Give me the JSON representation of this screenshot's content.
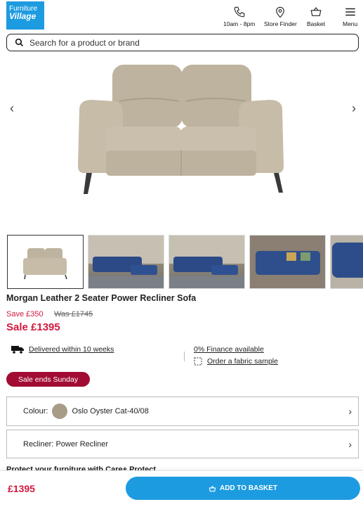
{
  "header": {
    "logo_line1": "Furniture",
    "logo_line2": "Village",
    "nav": [
      {
        "label": "10am - 8pm",
        "icon": "phone-icon"
      },
      {
        "label": "Store Finder",
        "icon": "location-pin-icon"
      },
      {
        "label": "Basket",
        "icon": "basket-icon"
      },
      {
        "label": "Menu",
        "icon": "hamburger-menu-icon"
      }
    ]
  },
  "search": {
    "placeholder": "Search for a product or brand"
  },
  "gallery": {
    "prev_arrow": "‹",
    "next_arrow": "›",
    "thumb_count_visible": 5
  },
  "product": {
    "title": "Morgan Leather 2 Seater Power Recliner Sofa",
    "save": "Save £350",
    "was": "Was £1745",
    "sale": "Sale £1395"
  },
  "features": {
    "delivery": "Delivered within 10 weeks",
    "finance": "0% Finance available",
    "fabric": "Order a fabric sample"
  },
  "badge": "Sale ends Sunday",
  "options": {
    "colour_label": "Colour:",
    "colour_value": "Oslo Oyster Cat-40/08",
    "colour_swatch": "#a89c88",
    "recliner": "Recliner: Power Recliner"
  },
  "care_protect": "Protect your furniture with Care+ Protect",
  "sticky": {
    "price": "£1395",
    "add_to_basket": "ADD TO BASKET"
  },
  "colors": {
    "brand_blue": "#1d9be0",
    "sale_red": "#d1183f",
    "badge_red": "#a10b34"
  }
}
